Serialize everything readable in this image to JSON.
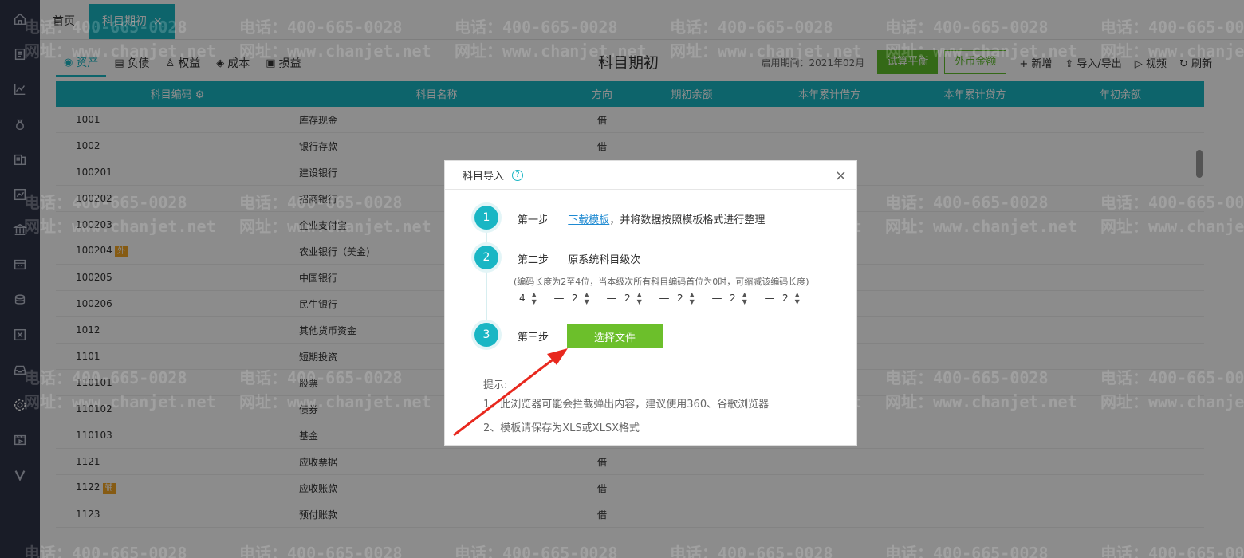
{
  "tabs": {
    "home": "首页",
    "current": "科目期初",
    "close_glyph": "×"
  },
  "sidebar": {
    "icons": [
      "home-icon",
      "document-icon",
      "chart-icon",
      "money-bag-icon",
      "ledger-icon",
      "report-icon",
      "bank-icon",
      "calculator-icon",
      "coins-icon",
      "voucher-icon",
      "inbox-icon",
      "gear-icon",
      "video-icon",
      "v-logo-icon"
    ],
    "active_index": 11
  },
  "categories": [
    {
      "label": "资产",
      "icon": "asset-icon"
    },
    {
      "label": "负债",
      "icon": "liability-icon"
    },
    {
      "label": "权益",
      "icon": "equity-icon"
    },
    {
      "label": "成本",
      "icon": "cost-icon"
    },
    {
      "label": "损益",
      "icon": "profit-icon"
    }
  ],
  "page": {
    "title": "科目期初",
    "period": "启用期间：2021年02月",
    "btn_trial": "试算平衡",
    "btn_foreign": "外币金额",
    "btn_add": "+ 新增",
    "btn_import": "导入/导出",
    "btn_video": "视频",
    "btn_refresh": "刷新"
  },
  "columns": [
    "科目编码",
    "科目名称",
    "方向",
    "期初余额",
    "本年累计借方",
    "本年累计贷方",
    "年初余额"
  ],
  "rows": [
    {
      "code": "1001",
      "name": "库存现金",
      "dir": "借",
      "badge": ""
    },
    {
      "code": "1002",
      "name": "银行存款",
      "dir": "借",
      "badge": ""
    },
    {
      "code": "100201",
      "name": "建设银行",
      "dir": "",
      "badge": ""
    },
    {
      "code": "100202",
      "name": "招商银行",
      "dir": "",
      "badge": ""
    },
    {
      "code": "100203",
      "name": "企业支付宝",
      "dir": "",
      "badge": ""
    },
    {
      "code": "100204",
      "name": "农业银行（美金)",
      "dir": "",
      "badge": "外"
    },
    {
      "code": "100205",
      "name": "中国银行",
      "dir": "",
      "badge": ""
    },
    {
      "code": "100206",
      "name": "民生银行",
      "dir": "",
      "badge": ""
    },
    {
      "code": "1012",
      "name": "其他货币资金",
      "dir": "",
      "badge": ""
    },
    {
      "code": "1101",
      "name": "短期投资",
      "dir": "",
      "badge": ""
    },
    {
      "code": "110101",
      "name": "股票",
      "dir": "",
      "badge": ""
    },
    {
      "code": "110102",
      "name": "债券",
      "dir": "",
      "badge": ""
    },
    {
      "code": "110103",
      "name": "基金",
      "dir": "",
      "badge": ""
    },
    {
      "code": "1121",
      "name": "应收票据",
      "dir": "借",
      "badge": ""
    },
    {
      "code": "1122",
      "name": "应收账款",
      "dir": "借",
      "badge": "辅"
    },
    {
      "code": "1123",
      "name": "预付账款",
      "dir": "借",
      "badge": ""
    }
  ],
  "watermark": {
    "phone": "电话：400-665-0028",
    "site": "网址：www.chanjet.net"
  },
  "modal": {
    "title": "科目导入",
    "help": "?",
    "close": "×",
    "step1_num": "1",
    "step1_label": "第一步",
    "step1_link": "下载模板",
    "step1_rest": "，并将数据按照模板格式进行整理",
    "step2_num": "2",
    "step2_label": "第二步",
    "step2_text": "原系统科目级次",
    "step2_note": "(编码长度为2至4位，当本级次所有科目编码首位为0时，可缩减该编码长度)",
    "levels": [
      "4",
      "2",
      "2",
      "2",
      "2",
      "2"
    ],
    "dash": "—",
    "step3_num": "3",
    "step3_label": "第三步",
    "btn_file": "选择文件",
    "tips_title": "提示:",
    "tip1": "1、此浏览器可能会拦截弹出内容，建议使用360、谷歌浏览器",
    "tip2": "2、模板请保存为XLS或XLSX格式"
  },
  "colors": {
    "accent": "#19b6c4",
    "green": "#5fbf2a",
    "sidebar": "#2f3347",
    "arrow": "#e8281e"
  }
}
